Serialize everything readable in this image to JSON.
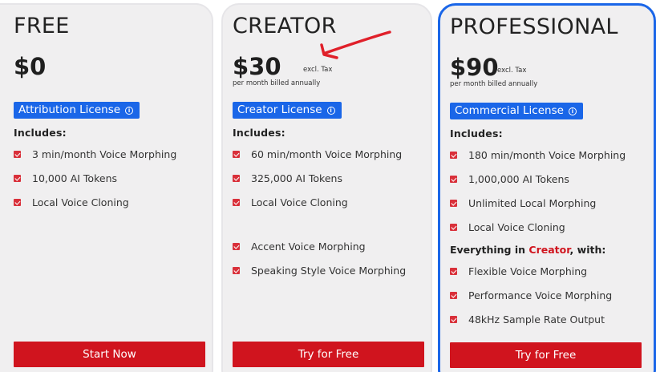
{
  "plans": [
    {
      "title": "FREE",
      "price": "$0",
      "license": "Attribution License",
      "includes_label": "Includes:",
      "features": [
        "3 min/month Voice Morphing",
        "10,000 AI Tokens",
        "Local Voice Cloning"
      ],
      "cta": "Start Now"
    },
    {
      "title": "CREATOR",
      "price": "$30",
      "tax_note": "excl. Tax",
      "billing": "per month billed annually",
      "license": "Creator License",
      "includes_label": "Includes:",
      "features": [
        "60 min/month Voice Morphing",
        "325,000 AI Tokens",
        "Local Voice Cloning",
        "Accent Voice Morphing",
        "Speaking Style Voice Morphing"
      ],
      "cta": "Try for Free"
    },
    {
      "title": "PROFESSIONAL",
      "price": "$90",
      "tax_note": "excl. Tax",
      "billing": "per month billed annually",
      "license": "Commercial License",
      "includes_label": "Includes:",
      "features": [
        "180 min/month Voice Morphing",
        "1,000,000 AI Tokens",
        "Unlimited Local Morphing",
        "Local Voice Cloning"
      ],
      "everything_prefix": "Everything in",
      "everything_highlight": "Creator",
      "everything_suffix": ", with:",
      "extra_features": [
        "Flexible Voice Morphing",
        "Performance Voice Morphing",
        "48kHz Sample Rate Output"
      ],
      "cta": "Try for Free"
    }
  ],
  "icons": {
    "check": "checkbox-checked-icon",
    "info": "info-circle-icon",
    "annotation": "red-arrow-annotation"
  },
  "colors": {
    "accent_blue": "#1a66e8",
    "cta_red": "#d0141e",
    "check_red": "#d9303a",
    "card_bg": "#f0eff0"
  }
}
